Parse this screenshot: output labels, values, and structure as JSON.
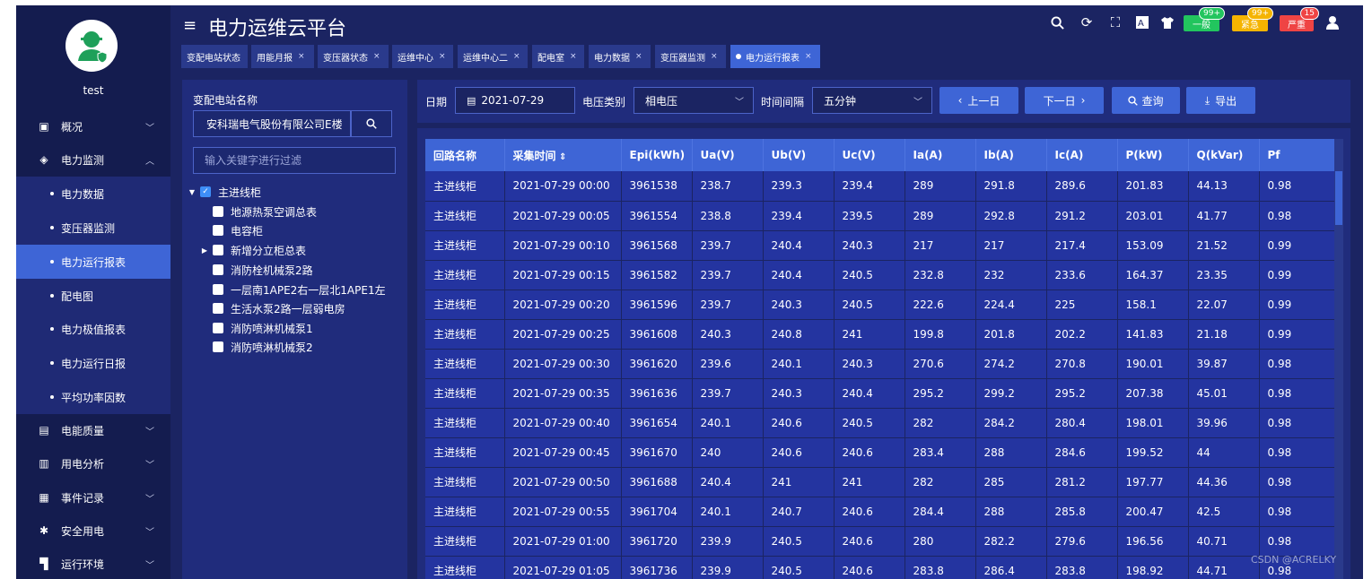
{
  "app": {
    "title": "电力运维云平台",
    "user_name": "test",
    "watermark": "CSDN @ACRELKY"
  },
  "sidebar": {
    "menu": [
      {
        "label": "概况",
        "icon": "overview-icon"
      },
      {
        "label": "电力监测",
        "icon": "power-monitor-icon"
      }
    ],
    "submenu": [
      {
        "label": "电力数据"
      },
      {
        "label": "变压器监测"
      },
      {
        "label": "电力运行报表"
      },
      {
        "label": "配电图"
      },
      {
        "label": "电力极值报表"
      },
      {
        "label": "电力运行日报"
      },
      {
        "label": "平均功率因数"
      }
    ],
    "menu_bottom": [
      {
        "label": "电能质量",
        "icon": "power-quality-icon"
      },
      {
        "label": "用电分析",
        "icon": "usage-analysis-icon"
      },
      {
        "label": "事件记录",
        "icon": "event-log-icon"
      },
      {
        "label": "安全用电",
        "icon": "safety-icon"
      },
      {
        "label": "运行环境",
        "icon": "environment-icon"
      }
    ]
  },
  "header": {
    "alarms": [
      {
        "label": "一般",
        "badge": "99+",
        "color": "#22c55e"
      },
      {
        "label": "紧急",
        "badge": "99+",
        "color": "#f5b400"
      },
      {
        "label": "严重",
        "badge": "15",
        "color": "#ef4444"
      }
    ],
    "tabs": [
      {
        "label": "变配电站状态"
      },
      {
        "label": "用能月报"
      },
      {
        "label": "变压器状态"
      },
      {
        "label": "运维中心"
      },
      {
        "label": "运维中心二"
      },
      {
        "label": "配电室"
      },
      {
        "label": "电力数据"
      },
      {
        "label": "变压器监测"
      },
      {
        "label": "电力运行报表"
      }
    ]
  },
  "tree": {
    "title": "变配电站名称",
    "station_value": "安科瑞电气股份有限公司E楼",
    "filter_placeholder": "输入关键字进行过滤",
    "root": "主进线柜",
    "children": [
      "地源热泵空调总表",
      "电容柜",
      "新增分立柜总表",
      "消防栓机械泵2路",
      "一层南1APE2右一层北1APE1左",
      "生活水泵2路一层弱电房",
      "消防喷淋机械泵1",
      "消防喷淋机械泵2"
    ]
  },
  "toolbar": {
    "date_label": "日期",
    "date_value": "2021-07-29",
    "voltage_label": "电压类别",
    "voltage_value": "相电压",
    "interval_label": "时间间隔",
    "interval_value": "五分钟",
    "prev_label": "上一日",
    "next_label": "下一日",
    "query_label": "查询",
    "export_label": "导出"
  },
  "table": {
    "headers": [
      "回路名称",
      "采集时间",
      "Epi(kWh)",
      "Ua(V)",
      "Ub(V)",
      "Uc(V)",
      "Ia(A)",
      "Ib(A)",
      "Ic(A)",
      "P(kW)",
      "Q(kVar)",
      "Pf"
    ],
    "rows": [
      [
        "主进线柜",
        "2021-07-29 00:00",
        "3961538",
        "238.7",
        "239.3",
        "239.4",
        "289",
        "291.8",
        "289.6",
        "201.83",
        "44.13",
        "0.98"
      ],
      [
        "主进线柜",
        "2021-07-29 00:05",
        "3961554",
        "238.8",
        "239.4",
        "239.5",
        "289",
        "292.8",
        "291.2",
        "203.01",
        "41.77",
        "0.98"
      ],
      [
        "主进线柜",
        "2021-07-29 00:10",
        "3961568",
        "239.7",
        "240.4",
        "240.3",
        "217",
        "217",
        "217.4",
        "153.09",
        "21.52",
        "0.99"
      ],
      [
        "主进线柜",
        "2021-07-29 00:15",
        "3961582",
        "239.7",
        "240.4",
        "240.5",
        "232.8",
        "232",
        "233.6",
        "164.37",
        "23.35",
        "0.99"
      ],
      [
        "主进线柜",
        "2021-07-29 00:20",
        "3961596",
        "239.7",
        "240.3",
        "240.5",
        "222.6",
        "224.4",
        "225",
        "158.1",
        "22.07",
        "0.99"
      ],
      [
        "主进线柜",
        "2021-07-29 00:25",
        "3961608",
        "240.3",
        "240.8",
        "241",
        "199.8",
        "201.8",
        "202.2",
        "141.83",
        "21.18",
        "0.99"
      ],
      [
        "主进线柜",
        "2021-07-29 00:30",
        "3961620",
        "239.6",
        "240.1",
        "240.3",
        "270.6",
        "274.2",
        "270.8",
        "190.01",
        "39.87",
        "0.98"
      ],
      [
        "主进线柜",
        "2021-07-29 00:35",
        "3961636",
        "239.7",
        "240.3",
        "240.4",
        "295.2",
        "299.2",
        "295.2",
        "207.38",
        "45.01",
        "0.98"
      ],
      [
        "主进线柜",
        "2021-07-29 00:40",
        "3961654",
        "240.1",
        "240.6",
        "240.5",
        "282",
        "284.2",
        "280.4",
        "198.01",
        "39.96",
        "0.98"
      ],
      [
        "主进线柜",
        "2021-07-29 00:45",
        "3961670",
        "240",
        "240.6",
        "240.6",
        "283.4",
        "288",
        "284.6",
        "199.52",
        "44",
        "0.98"
      ],
      [
        "主进线柜",
        "2021-07-29 00:50",
        "3961688",
        "240.4",
        "241",
        "241",
        "282",
        "285",
        "281.2",
        "197.77",
        "44.36",
        "0.98"
      ],
      [
        "主进线柜",
        "2021-07-29 00:55",
        "3961704",
        "240.1",
        "240.7",
        "240.6",
        "284.4",
        "288",
        "285.8",
        "200.47",
        "42.5",
        "0.98"
      ],
      [
        "主进线柜",
        "2021-07-29 01:00",
        "3961720",
        "239.9",
        "240.5",
        "240.6",
        "280",
        "282.2",
        "279.6",
        "196.56",
        "40.71",
        "0.98"
      ],
      [
        "主进线柜",
        "2021-07-29 01:05",
        "3961736",
        "239.9",
        "240.5",
        "240.6",
        "283.8",
        "286.4",
        "283.8",
        "198.92",
        "44.71",
        "0.98"
      ]
    ]
  }
}
